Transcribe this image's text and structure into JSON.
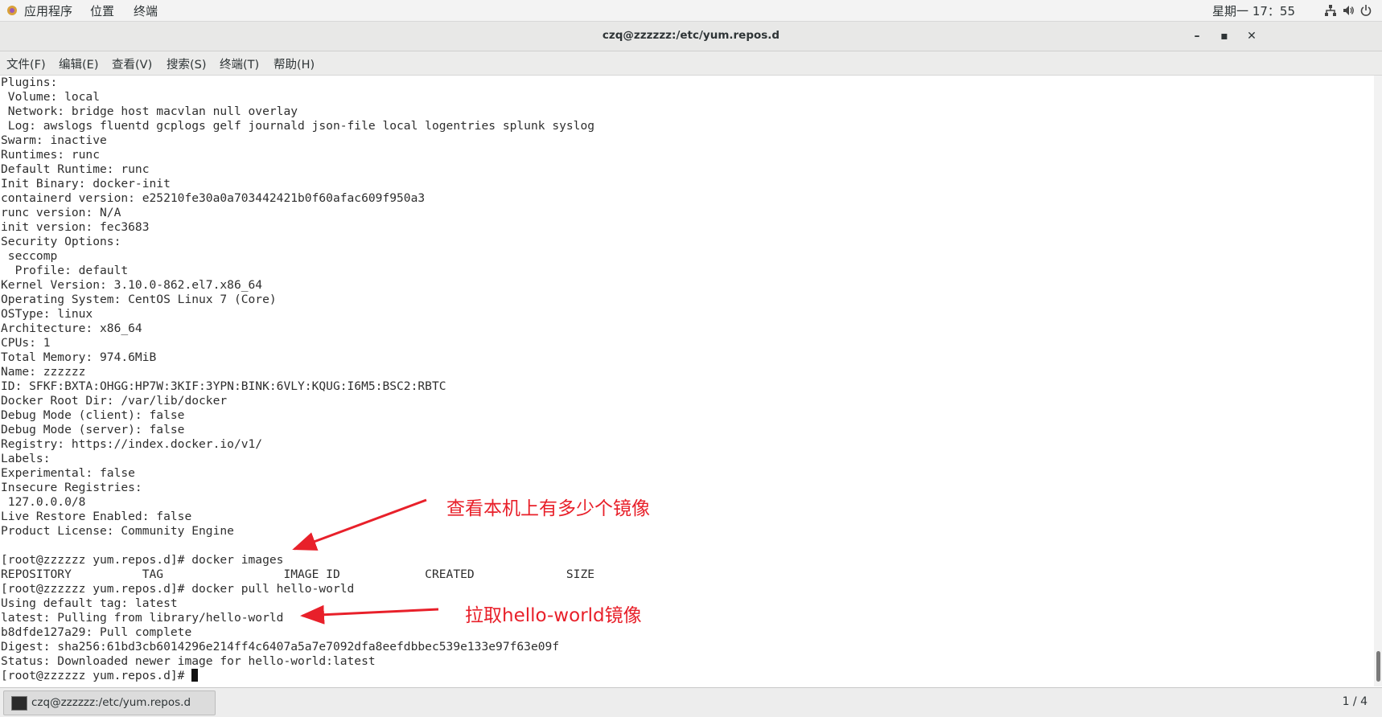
{
  "top_panel": {
    "apps_label": "应用程序",
    "places_label": "位置",
    "terminal_label": "终端",
    "clock": "星期一 17：55"
  },
  "window": {
    "title": "czq@zzzzzz:/etc/yum.repos.d",
    "minimize": "–",
    "maximize": "▪",
    "close": "✕"
  },
  "menu": {
    "file": "文件(F)",
    "edit": "编辑(E)",
    "view": "查看(V)",
    "search": "搜索(S)",
    "terminal": "终端(T)",
    "help": "帮助(H)"
  },
  "terminal_lines": [
    "Plugins:",
    " Volume: local",
    " Network: bridge host macvlan null overlay",
    " Log: awslogs fluentd gcplogs gelf journald json-file local logentries splunk syslog",
    "Swarm: inactive",
    "Runtimes: runc",
    "Default Runtime: runc",
    "Init Binary: docker-init",
    "containerd version: e25210fe30a0a703442421b0f60afac609f950a3",
    "runc version: N/A",
    "init version: fec3683",
    "Security Options:",
    " seccomp",
    "  Profile: default",
    "Kernel Version: 3.10.0-862.el7.x86_64",
    "Operating System: CentOS Linux 7 (Core)",
    "OSType: linux",
    "Architecture: x86_64",
    "CPUs: 1",
    "Total Memory: 974.6MiB",
    "Name: zzzzzz",
    "ID: SFKF:BXTA:OHGG:HP7W:3KIF:3YPN:BINK:6VLY:KQUG:I6M5:BSC2:RBTC",
    "Docker Root Dir: /var/lib/docker",
    "Debug Mode (client): false",
    "Debug Mode (server): false",
    "Registry: https://index.docker.io/v1/",
    "Labels:",
    "Experimental: false",
    "Insecure Registries:",
    " 127.0.0.0/8",
    "Live Restore Enabled: false",
    "Product License: Community Engine",
    "",
    "[root@zzzzzz yum.repos.d]# docker images",
    "REPOSITORY          TAG                 IMAGE ID            CREATED             SIZE",
    "[root@zzzzzz yum.repos.d]# docker pull hello-world",
    "Using default tag: latest",
    "latest: Pulling from library/hello-world",
    "b8dfde127a29: Pull complete",
    "Digest: sha256:61bd3cb6014296e214ff4c6407a5a7e7092dfa8eefdbbec539e133e97f63e09f",
    "Status: Downloaded newer image for hello-world:latest"
  ],
  "prompt": "[root@zzzzzz yum.repos.d]# ",
  "annotations": {
    "images_note": "查看本机上有多少个镜像",
    "pull_note": "拉取hello-world镜像",
    "color": "#e8202a"
  },
  "taskbar": {
    "task_label": "czq@zzzzzz:/etc/yum.repos.d",
    "workspace": "1 / 4"
  }
}
